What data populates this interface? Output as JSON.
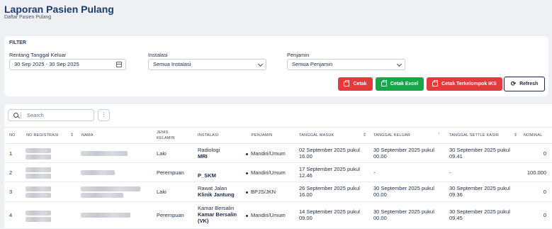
{
  "header": {
    "title": "Laporan Pasien Pulang",
    "subtitle": "Daftar Pasien Pulang"
  },
  "filter": {
    "title": "FILTER",
    "date_label": "Rentang Tanggal Keluar",
    "date_value": "30 Sep 2025 - 30 Sep 2025",
    "instalasi_label": "Instalasi",
    "instalasi_value": "Semua Instalasi",
    "penjamin_label": "Penjamin",
    "penjamin_value": "Semua Penjamin"
  },
  "buttons": {
    "cetak": "Cetak",
    "cetak_excel": "Cetak Excel",
    "cetak_terkelompok": "Cetak Terkelompok IKS",
    "refresh": "Refresh"
  },
  "table": {
    "search_placeholder": "Search",
    "columns": {
      "no": "NO",
      "no_registrasi": "NO REGISTRASI",
      "nama": "NAMA",
      "jenis_kelamin_1": "JENIS",
      "jenis_kelamin_2": "KELAMIN",
      "instalasi": "INSTALASI",
      "penjamin": "PENJAMIN",
      "tanggal_masuk": "TANGGAL MASUK",
      "tanggal_keluar": "TANGGAL KELUAR",
      "tanggal_settle": "TANGGAL SETTLE KASIR",
      "nominal": "NOMINAL"
    },
    "rows": [
      {
        "no": "1",
        "jk": "Laki",
        "inst1": "Radiologi",
        "inst2": "MRI",
        "inst3": "",
        "penjamin": "Mandiri/Umum",
        "masuk1": "02 September 2025 pukul",
        "masuk2": "16.00",
        "keluar1": "30 September 2025 pukul",
        "keluar2": "00.00",
        "settle1": "30 September 2025 pukul",
        "settle2": "09.41",
        "nominal": "0"
      },
      {
        "no": "2",
        "jk": "Perempuan",
        "inst1": "",
        "inst2": "P_SKM",
        "inst3": "",
        "penjamin": "Mandiri/Umum",
        "masuk1": "17 September 2025 pukul",
        "masuk2": "12.46",
        "keluar1": "-",
        "keluar2": "",
        "settle1": "-",
        "settle2": "",
        "nominal": "100.000"
      },
      {
        "no": "3",
        "jk": "Laki",
        "inst1": "Rawat Jalan",
        "inst2": "Klinik Jantung",
        "inst3": "",
        "penjamin": "BPJS/JKN",
        "masuk1": "26 September 2025 pukul",
        "masuk2": "16.00",
        "keluar1": "30 September 2025 pukul",
        "keluar2": "00.00",
        "settle1": "30 September 2025 pukul",
        "settle2": "09.36",
        "nominal": "0"
      },
      {
        "no": "4",
        "jk": "Perempuan",
        "inst1": "Kamar Bersalin",
        "inst2": "Kamar Bersalin",
        "inst3": "(VK)",
        "penjamin": "Mandiri/Umum",
        "masuk1": "14 September 2025 pukul",
        "masuk2": "09.00",
        "keluar1": "30 September 2025 pukul",
        "keluar2": "00.00",
        "settle1": "30 September 2025 pukul",
        "settle2": "09.45",
        "nominal": "0"
      }
    ]
  },
  "colors": {
    "primary": "#1d3a6e",
    "danger": "#e23b3b",
    "success": "#19a54a"
  }
}
